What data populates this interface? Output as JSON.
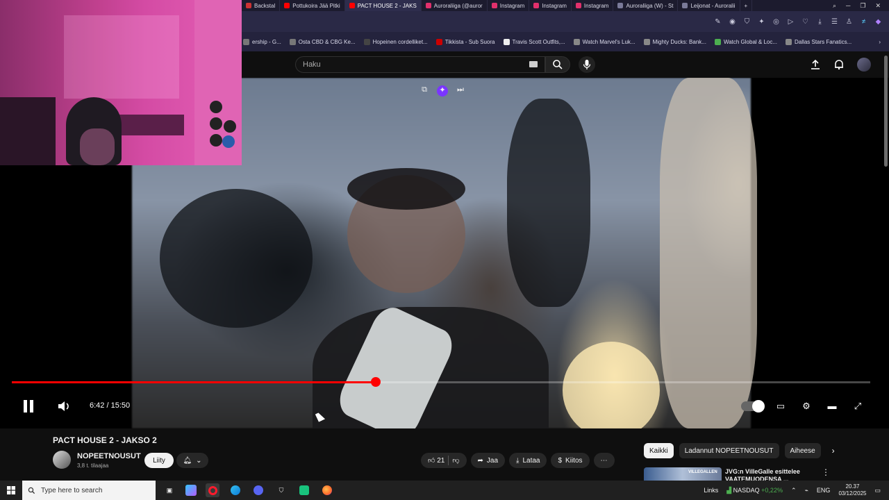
{
  "browser": {
    "tabs": [
      {
        "label": "Backstal",
        "color": "#cc3333",
        "active": false
      },
      {
        "label": "Pottukoira Jää Pitki",
        "color": "#ff0000",
        "active": false
      },
      {
        "label": "PACT HOUSE 2 - JAKS",
        "color": "#ff0000",
        "active": true
      },
      {
        "label": "Auroraliiga (@auror",
        "color": "#e1306c",
        "active": false
      },
      {
        "label": "Instagram",
        "color": "#e1306c",
        "active": false
      },
      {
        "label": "Instagram",
        "color": "#e1306c",
        "active": false
      },
      {
        "label": "Instagram",
        "color": "#e1306c",
        "active": false
      },
      {
        "label": "Auroraliiga (W) - St",
        "color": "#7a7a99",
        "active": false
      },
      {
        "label": "Leijonat - Auroralii",
        "color": "#7a7a99",
        "active": false
      }
    ],
    "new_tab": "+",
    "bookmarks": [
      {
        "label": "ership - G...",
        "icon_color": "#777"
      },
      {
        "label": "Osta CBD & CBG Ke...",
        "icon_color": "#777"
      },
      {
        "label": "Hopeinen cordelliket...",
        "icon_color": "#444"
      },
      {
        "label": "Tikkista - Sub Suora",
        "icon_color": "#cc0000"
      },
      {
        "label": "Travis Scott Outfits,...",
        "icon_color": "#eeeeee"
      },
      {
        "label": "Watch Marvel's Luk...",
        "icon_color": "#888"
      },
      {
        "label": "Mighty Ducks: Bank...",
        "icon_color": "#888"
      },
      {
        "label": "Watch Global & Loc...",
        "icon_color": "#4caf50"
      },
      {
        "label": "Dallas Stars Fanatics...",
        "icon_color": "#888"
      }
    ],
    "bookmarks_more": "›"
  },
  "youtube": {
    "search_placeholder": "Haku",
    "video": {
      "title": "PACT HOUSE 2 - JAKSO 2",
      "current_time": "6:42",
      "duration": "15:50",
      "time_display": "6:42 / 15:50",
      "progress_fraction": 0.424
    },
    "channel": {
      "name": "NOPEETNOUSUT",
      "subscribers": "3,8 t. tilaajaa",
      "join_label": "Liity"
    },
    "actions": {
      "like_count": "21",
      "share_label": "Jaa",
      "download_label": "Lataa",
      "thanks_label": "Kiitos"
    },
    "chips": [
      {
        "label": "Kaikki",
        "active": true
      },
      {
        "label": "Ladannut NOPEETNOUSUT",
        "active": false
      },
      {
        "label": "Aiheese",
        "active": false
      }
    ],
    "recommendation": {
      "title": "JVG:n VilleGalle esittelee VAATEMUODENSA ...",
      "thumb_text": "VILLEGALLEN"
    }
  },
  "taskbar": {
    "search_placeholder": "Type here to search",
    "links_label": "Links",
    "ticker_name": "NASDAQ",
    "ticker_change": "+0,22%",
    "language": "ENG",
    "time": "20.37",
    "date": "03/12/2025"
  },
  "colors": {
    "accent_red": "#ff0000",
    "bg": "#0f0f0f",
    "taskbar": "#202020"
  }
}
